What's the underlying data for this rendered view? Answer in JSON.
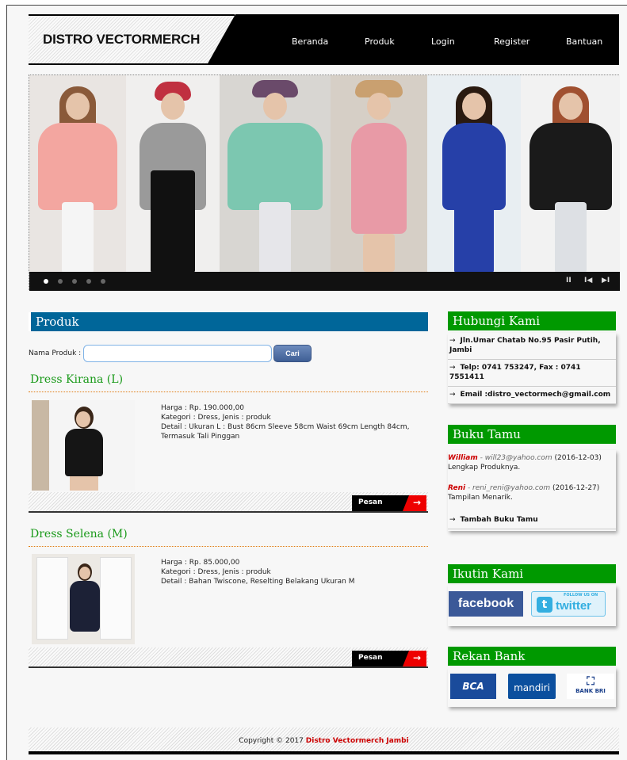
{
  "header": {
    "logo": "DISTRO VECTORMERCH",
    "nav": [
      "Beranda",
      "Produk",
      "Login",
      "Register",
      "Bantuan"
    ]
  },
  "slider": {
    "dot_count": 5,
    "active_dot": 1,
    "controls": {
      "pause": "II",
      "prev": "I◀",
      "next": "▶I"
    }
  },
  "products_section": {
    "heading": "Produk",
    "search_label": "Nama Produk :",
    "search_value": "",
    "search_button": "Cari",
    "items": [
      {
        "name": "Dress Kirana (L)",
        "price": "Harga : Rp. 190.000,00",
        "category": "Kategori : Dress, Jenis : produk",
        "detail": "Detail : Ukuran L : Bust 86cm Sleeve 58cm Waist 69cm Length 84cm, Termasuk Tali Pinggan",
        "order_label": "Pesan"
      },
      {
        "name": "Dress Selena (M)",
        "price": "Harga : Rp. 85.000,00",
        "category": "Kategori : Dress, Jenis : produk",
        "detail": "Detail : Bahan Twiscone, Reselting Belakang Ukuran M",
        "order_label": "Pesan"
      }
    ]
  },
  "sidebar": {
    "contact": {
      "heading": "Hubungi Kami",
      "lines": [
        "Jln.Umar Chatab No.95 Pasir Putih, Jambi",
        "Telp: 0741 753247, Fax : 0741 7551411",
        "Email :distro_vectormech@gmail.com"
      ]
    },
    "guestbook": {
      "heading": "Buku Tamu",
      "entries": [
        {
          "name": "William",
          "email": "- will23@yahoo.com",
          "date": "(2016-12-03)",
          "message": "Lengkap Produknya."
        },
        {
          "name": "Reni",
          "email": "- reni_reni@yahoo.com",
          "date": "(2016-12-27)",
          "message": "Tampilan Menarik."
        }
      ],
      "add_link": "Tambah Buku Tamu"
    },
    "follow": {
      "heading": "Ikutin Kami",
      "facebook": "facebook",
      "twitter": "twitter",
      "twitter_small": "FOLLOW US ON"
    },
    "bank": {
      "heading": "Rekan Bank",
      "bca": "BCA",
      "mandiri": "mandiri",
      "bri": "BANK BRI"
    }
  },
  "footer": {
    "prefix": "Copyright © 2017",
    "brand": "Distro Vectormerch Jambi"
  }
}
